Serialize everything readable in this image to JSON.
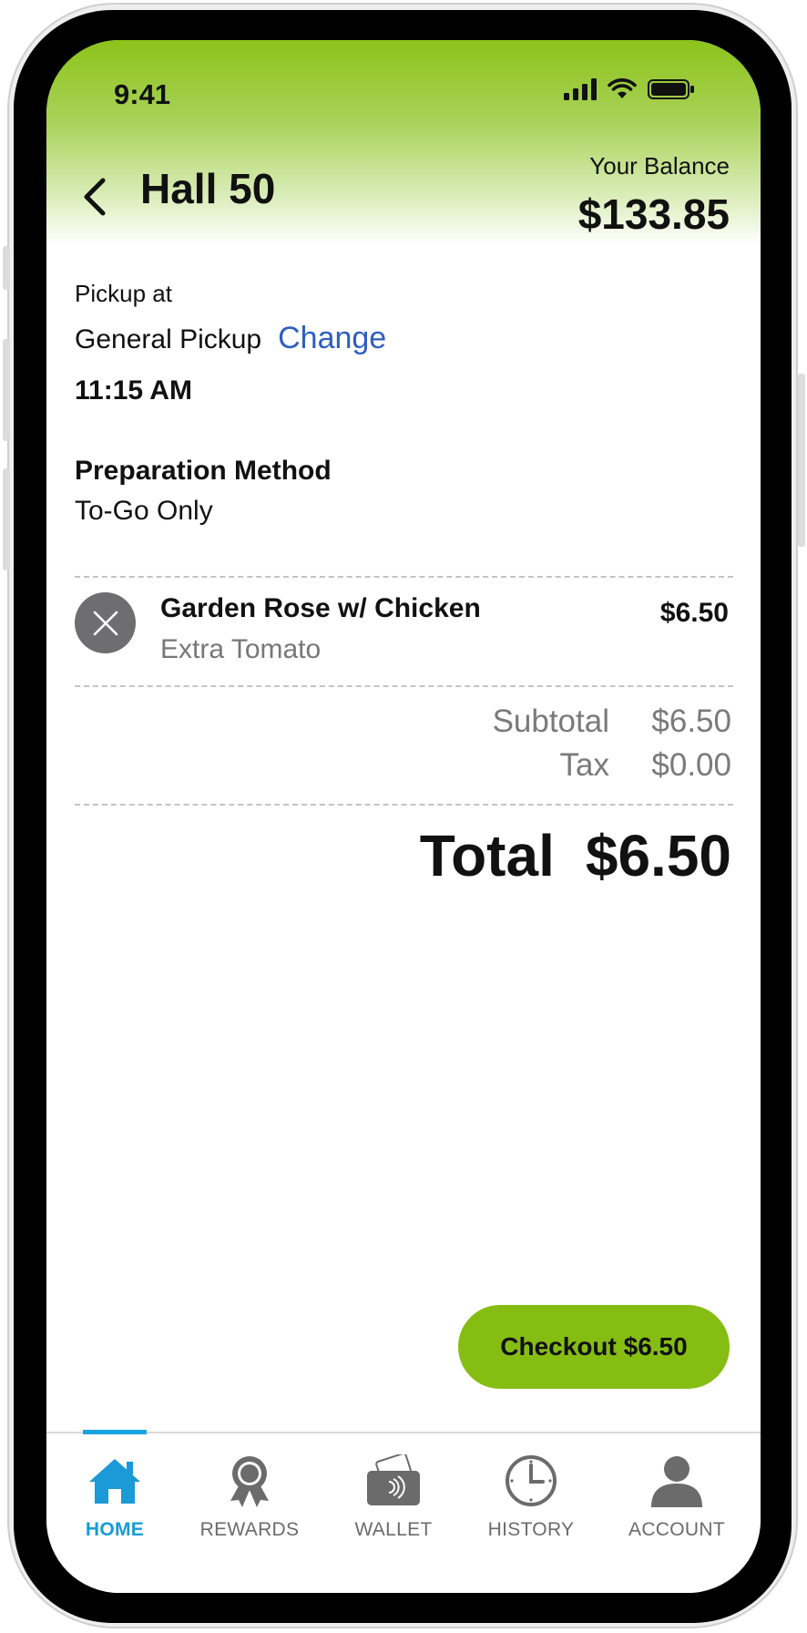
{
  "status_bar": {
    "time": "9:41"
  },
  "header": {
    "title": "Hall 50",
    "balance_label": "Your Balance",
    "balance_value": "$133.85"
  },
  "pickup": {
    "label": "Pickup at",
    "location": "General Pickup",
    "change_label": "Change",
    "time": "11:15 AM"
  },
  "preparation": {
    "label": "Preparation Method",
    "value": "To-Go Only"
  },
  "order_item": {
    "name": "Garden Rose w/ Chicken",
    "modifier": "Extra Tomato",
    "price": "$6.50"
  },
  "summary": {
    "subtotal_label": "Subtotal",
    "subtotal_value": "$6.50",
    "tax_label": "Tax",
    "tax_value": "$0.00",
    "total_label": "Total",
    "total_value": "$6.50"
  },
  "checkout": {
    "label": "Checkout $6.50"
  },
  "tabs": [
    {
      "label": "HOME",
      "icon": "home-icon",
      "active": true
    },
    {
      "label": "REWARDS",
      "icon": "rewards-ribbon-icon",
      "active": false
    },
    {
      "label": "WALLET",
      "icon": "wallet-card-icon",
      "active": false
    },
    {
      "label": "HISTORY",
      "icon": "clock-icon",
      "active": false
    },
    {
      "label": "ACCOUNT",
      "icon": "person-icon",
      "active": false
    }
  ],
  "colors": {
    "brand_green": "#86bd13",
    "link_blue": "#2e5fbd",
    "active_tab_blue": "#1a9ad6"
  }
}
